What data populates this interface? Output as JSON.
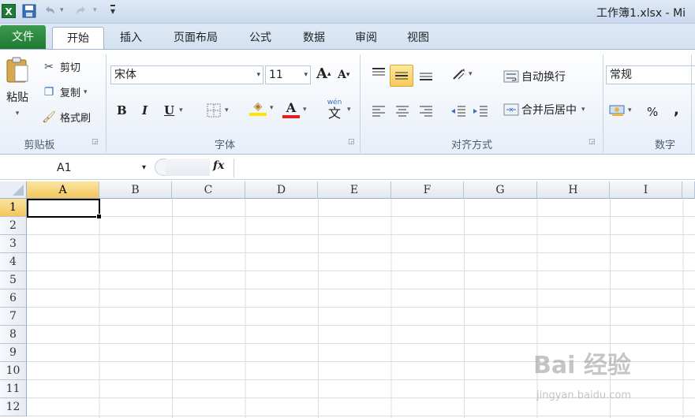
{
  "window": {
    "title": "工作簿1.xlsx - Mi",
    "app_icon_letter": "X"
  },
  "quick_access": {
    "undo_arrow": "▾",
    "redo_arrow": "▾",
    "customize": "▾"
  },
  "tabs": [
    {
      "label": "文件"
    },
    {
      "label": "开始"
    },
    {
      "label": "插入"
    },
    {
      "label": "页面布局"
    },
    {
      "label": "公式"
    },
    {
      "label": "数据"
    },
    {
      "label": "审阅"
    },
    {
      "label": "视图"
    }
  ],
  "ribbon": {
    "clipboard": {
      "paste": "粘贴",
      "cut": "剪切",
      "copy": "复制",
      "format_painter": "格式刷",
      "label": "剪贴板"
    },
    "font": {
      "font_name": "宋体",
      "font_size": "11",
      "bold": "B",
      "italic": "I",
      "underline": "U",
      "font_color_letter": "A",
      "phonetic": "wén",
      "label": "字体"
    },
    "alignment": {
      "wrap_text": "自动换行",
      "merge_center": "合并后居中",
      "label": "对齐方式"
    },
    "number": {
      "format": "常规",
      "percent": "%",
      "comma": ",",
      "label": "数字"
    }
  },
  "formula_bar": {
    "name_box": "A1",
    "fx": "fx",
    "content": ""
  },
  "grid": {
    "columns": [
      "A",
      "B",
      "C",
      "D",
      "E",
      "F",
      "G",
      "H",
      "I"
    ],
    "rows": [
      "1",
      "2",
      "3",
      "4",
      "5",
      "6",
      "7",
      "8",
      "9",
      "10",
      "11",
      "12"
    ],
    "selected_cell": "A1"
  },
  "watermark": {
    "main": "Bai 经验",
    "sub": "jingyan.baidu.com"
  },
  "colors": {
    "file_tab": "#1f7a34",
    "highlight": "#f7c95b",
    "font_color_bar": "#e02020",
    "fill_color_bar": "#ffe600"
  }
}
